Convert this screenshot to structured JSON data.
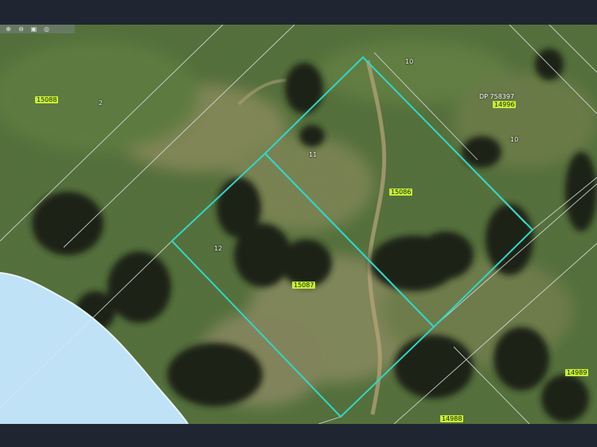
{
  "toolbar": {
    "tools": [
      {
        "icon": "search-plus-icon",
        "glyph": "⊕"
      },
      {
        "icon": "search-minus-icon",
        "glyph": "⊖"
      },
      {
        "icon": "print-icon",
        "glyph": "▣"
      },
      {
        "icon": "layers-icon",
        "glyph": "◎"
      }
    ]
  },
  "colors": {
    "frame": "#1f2631",
    "imagery_base": "#4c6a34",
    "water": "#bfe2f6",
    "highlight_boundary": "#31d6c8",
    "cadastre_lines": "#dfe6e6",
    "parcel_label_bg": "#c6ec3a"
  },
  "map": {
    "lot_labels": {
      "lot_2": "2",
      "lot_10_north": "10",
      "lot_10_east": "10",
      "lot_11": "11",
      "lot_12": "12"
    },
    "parcel_labels": {
      "p15088": "15088",
      "p14996": "14996",
      "p15086": "15086",
      "p15087": "15087",
      "p14989": "14989",
      "p14988": "14988"
    },
    "plan_label": "DP 758397"
  }
}
